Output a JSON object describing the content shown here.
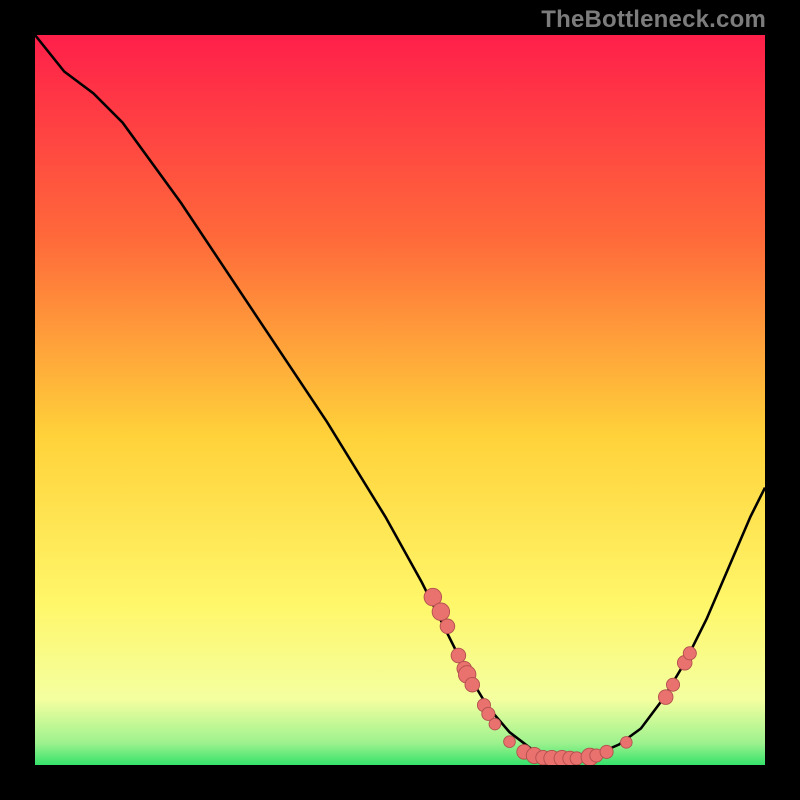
{
  "watermark": "TheBottleneck.com",
  "colors": {
    "black": "#000000",
    "curve": "#000000",
    "dot_fill": "#e9716e",
    "dot_stroke": "#b14f4d",
    "grad_top": "#ff1f4a",
    "grad_mid1": "#ff7a3a",
    "grad_mid2": "#ffd23a",
    "grad_mid3": "#fff76a",
    "grad_bottom": "#35e26a"
  },
  "chart_data": {
    "type": "line",
    "title": "",
    "xlabel": "",
    "ylabel": "",
    "x_range": [
      0,
      100
    ],
    "y_range": [
      0,
      100
    ],
    "curve": [
      {
        "x": 0,
        "y": 100
      },
      {
        "x": 4,
        "y": 95
      },
      {
        "x": 8,
        "y": 92
      },
      {
        "x": 12,
        "y": 88
      },
      {
        "x": 20,
        "y": 77
      },
      {
        "x": 30,
        "y": 62
      },
      {
        "x": 40,
        "y": 47
      },
      {
        "x": 48,
        "y": 34
      },
      {
        "x": 53,
        "y": 25
      },
      {
        "x": 56,
        "y": 19
      },
      {
        "x": 59,
        "y": 13
      },
      {
        "x": 62,
        "y": 8
      },
      {
        "x": 65,
        "y": 4.5
      },
      {
        "x": 68,
        "y": 2.2
      },
      {
        "x": 71,
        "y": 1.2
      },
      {
        "x": 74,
        "y": 1.0
      },
      {
        "x": 77,
        "y": 1.5
      },
      {
        "x": 80,
        "y": 2.8
      },
      {
        "x": 83,
        "y": 5
      },
      {
        "x": 86,
        "y": 9
      },
      {
        "x": 89,
        "y": 14
      },
      {
        "x": 92,
        "y": 20
      },
      {
        "x": 95,
        "y": 27
      },
      {
        "x": 98,
        "y": 34
      },
      {
        "x": 100,
        "y": 38
      }
    ],
    "dots": [
      {
        "x": 54.5,
        "y": 23,
        "r": 1.2
      },
      {
        "x": 55.6,
        "y": 21,
        "r": 1.2
      },
      {
        "x": 56.5,
        "y": 19,
        "r": 1.0
      },
      {
        "x": 58.0,
        "y": 15.0,
        "r": 1.0
      },
      {
        "x": 58.8,
        "y": 13.2,
        "r": 1.0
      },
      {
        "x": 59.2,
        "y": 12.4,
        "r": 1.2
      },
      {
        "x": 59.9,
        "y": 11.0,
        "r": 1.0
      },
      {
        "x": 61.5,
        "y": 8.2,
        "r": 0.9
      },
      {
        "x": 62.1,
        "y": 7.0,
        "r": 0.9
      },
      {
        "x": 63.0,
        "y": 5.6,
        "r": 0.8
      },
      {
        "x": 65.0,
        "y": 3.2,
        "r": 0.8
      },
      {
        "x": 67.0,
        "y": 1.8,
        "r": 1.0
      },
      {
        "x": 68.4,
        "y": 1.3,
        "r": 1.1
      },
      {
        "x": 69.6,
        "y": 1.0,
        "r": 1.0
      },
      {
        "x": 70.8,
        "y": 0.9,
        "r": 1.1
      },
      {
        "x": 72.2,
        "y": 0.9,
        "r": 1.1
      },
      {
        "x": 73.3,
        "y": 0.9,
        "r": 1.0
      },
      {
        "x": 74.2,
        "y": 0.9,
        "r": 0.9
      },
      {
        "x": 76.0,
        "y": 1.1,
        "r": 1.2
      },
      {
        "x": 76.9,
        "y": 1.3,
        "r": 0.9
      },
      {
        "x": 78.3,
        "y": 1.8,
        "r": 0.9
      },
      {
        "x": 81.0,
        "y": 3.1,
        "r": 0.8
      },
      {
        "x": 86.4,
        "y": 9.3,
        "r": 1.0
      },
      {
        "x": 87.4,
        "y": 11.0,
        "r": 0.9
      },
      {
        "x": 89.0,
        "y": 14.0,
        "r": 1.0
      },
      {
        "x": 89.7,
        "y": 15.3,
        "r": 0.9
      }
    ]
  }
}
